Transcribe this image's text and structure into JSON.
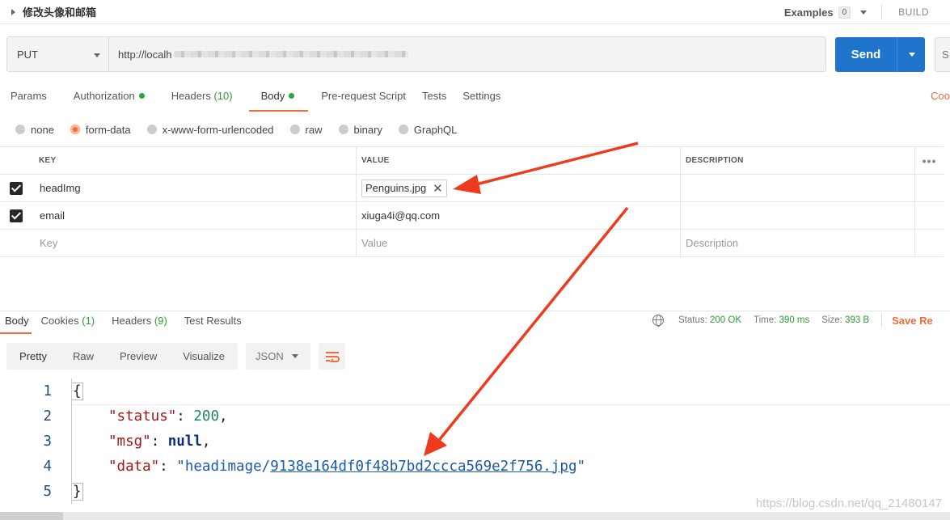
{
  "request": {
    "title": "修改头像和邮箱",
    "examples_label": "Examples",
    "examples_count": "0",
    "build_label": "BUILD",
    "method": "PUT",
    "url": "http://localh",
    "send_label": "Send",
    "save_stub": "S"
  },
  "req_tabs": {
    "params": "Params",
    "authorization": "Authorization",
    "headers": "Headers",
    "headers_count": "(10)",
    "body": "Body",
    "prerequest": "Pre-request Script",
    "tests": "Tests",
    "settings": "Settings",
    "cookies": "Coo"
  },
  "body_types": {
    "none": "none",
    "form_data": "form-data",
    "urlencoded": "x-www-form-urlencoded",
    "raw": "raw",
    "binary": "binary",
    "graphql": "GraphQL"
  },
  "params_table": {
    "headers": {
      "key": "KEY",
      "value": "VALUE",
      "description": "DESCRIPTION",
      "more": "•••"
    },
    "rows": [
      {
        "key": "headImg",
        "value": "Penguins.jpg"
      },
      {
        "key": "email",
        "value": "xiuga4i@qq.com"
      }
    ],
    "placeholders": {
      "key": "Key",
      "value": "Value",
      "description": "Description"
    }
  },
  "response": {
    "tabs": {
      "body": "Body",
      "cookies": "Cookies",
      "cookies_count": "(1)",
      "headers": "Headers",
      "headers_count": "(9)",
      "test_results": "Test Results"
    },
    "meta": {
      "status_label": "Status:",
      "status_value": "200 OK",
      "time_label": "Time:",
      "time_value": "390 ms",
      "size_label": "Size:",
      "size_value": "393 B",
      "save_label": "Save Re"
    },
    "modes": {
      "pretty": "Pretty",
      "raw": "Raw",
      "preview": "Preview",
      "visualize": "Visualize"
    },
    "format": "JSON",
    "code": {
      "line_numbers": [
        "1",
        "2",
        "3",
        "4",
        "5"
      ],
      "open_brace": "{",
      "close_brace": "}",
      "status_key": "\"status\"",
      "status_value": "200",
      "msg_key": "\"msg\"",
      "msg_value": "null",
      "data_key": "\"data\"",
      "data_prefix": "\"headimage/",
      "data_link": "9138e164df0f48b7bd2ccca569e2f756.jpg",
      "data_suffix": "\""
    }
  },
  "watermark": "https://blog.csdn.net/qq_21480147",
  "colors": {
    "accent": "#f26b3a",
    "send": "#1f75cb",
    "status_green": "#2c9b32",
    "arrow": "#ee3b1f"
  }
}
